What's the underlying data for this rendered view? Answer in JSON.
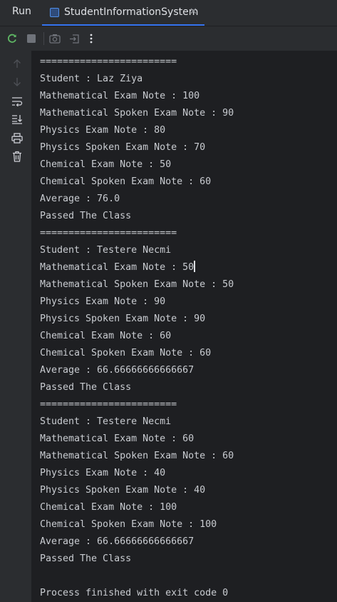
{
  "run_panel": {
    "title": "Run",
    "tab_label": "StudentInformationSystem"
  },
  "toolbar": {
    "icons": [
      "rerun-icon",
      "stop-icon",
      "camera-icon",
      "exit-icon",
      "more-icon"
    ]
  },
  "sidebar": {
    "icons": [
      "arrow-up-icon",
      "arrow-down-icon",
      "soft-wrap-icon",
      "scroll-to-end-icon",
      "print-icon",
      "trash-icon"
    ]
  },
  "console": {
    "lines": [
      "========================",
      "Student : Laz Ziya",
      "Mathematical Exam Note : 100",
      "Mathematical Spoken Exam Note : 90",
      "Physics Exam Note : 80",
      "Physics Spoken Exam Note : 70",
      "Chemical Exam Note : 50",
      "Chemical Spoken Exam Note : 60",
      "Average : 76.0",
      "Passed The Class",
      "========================",
      "Student : Testere Necmi",
      "Mathematical Exam Note : 50",
      "Mathematical Spoken Exam Note : 50",
      "Physics Exam Note : 90",
      "Physics Spoken Exam Note : 90",
      "Chemical Exam Note : 60",
      "Chemical Spoken Exam Note : 60",
      "Average : 66.66666666666667",
      "Passed The Class",
      "========================",
      "Student : Testere Necmi",
      "Mathematical Exam Note : 60",
      "Mathematical Spoken Exam Note : 60",
      "Physics Exam Note : 40",
      "Physics Spoken Exam Note : 40",
      "Chemical Exam Note : 100",
      "Chemical Spoken Exam Note : 100",
      "Average : 66.66666666666667",
      "Passed The Class",
      "",
      "Process finished with exit code 0"
    ]
  },
  "colors": {
    "background": "#1e1f22",
    "panel": "#2b2d30",
    "accent": "#3574f0",
    "text": "#c9ccd1",
    "rerun_icon": "#5fb865"
  }
}
